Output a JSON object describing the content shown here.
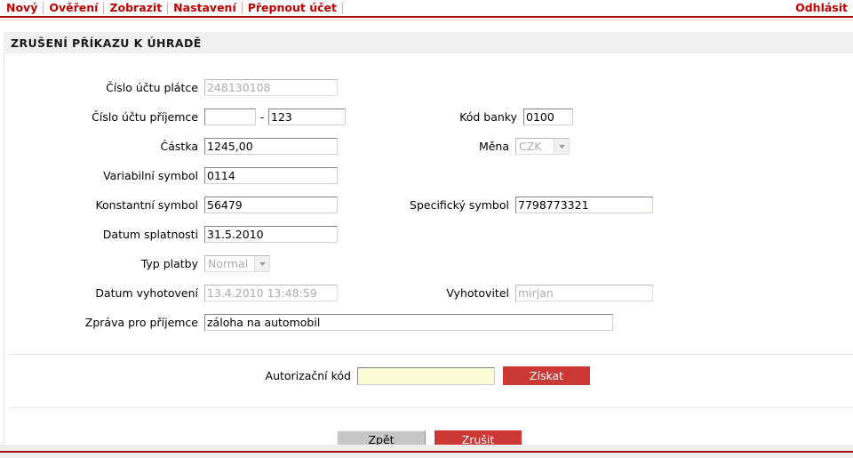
{
  "menu": {
    "items": [
      {
        "label": "Nový"
      },
      {
        "label": "Ověření"
      },
      {
        "label": "Zobrazit"
      },
      {
        "label": "Nastavení"
      },
      {
        "label": "Přepnout účet"
      }
    ],
    "logout_label": "Odhlásit"
  },
  "page": {
    "title": "ZRUŠENÍ PŘÍKAZU K ÚHRADĚ"
  },
  "form": {
    "payer_account": {
      "label": "Číslo účtu plátce",
      "value": "248130108",
      "disabled": true
    },
    "recipient_account": {
      "label": "Číslo účtu příjemce",
      "prefix_value": "",
      "separator": "-",
      "number_value": "123"
    },
    "bank_code": {
      "label": "Kód banky",
      "value": "0100"
    },
    "amount": {
      "label": "Částka",
      "value": "1245,00"
    },
    "currency": {
      "label": "Měna",
      "value": "CZK",
      "disabled": true,
      "options": [
        "CZK"
      ]
    },
    "variable_symbol": {
      "label": "Variabilní symbol",
      "value": "0114"
    },
    "constant_symbol": {
      "label": "Konstantní symbol",
      "value": "56479"
    },
    "specific_symbol": {
      "label": "Specifický symbol",
      "value": "7798773321"
    },
    "due_date": {
      "label": "Datum splatnosti",
      "value": "31.5.2010"
    },
    "payment_type": {
      "label": "Typ platby",
      "value": "Normal",
      "disabled": true,
      "options": [
        "Normal"
      ]
    },
    "created_date": {
      "label": "Datum vyhotovení",
      "value": "13.4.2010 13:48:59",
      "disabled": true
    },
    "creator": {
      "label": "Vyhotovitel",
      "value": "mirjan",
      "disabled": true
    },
    "message": {
      "label": "Zpráva pro příjemce",
      "value": "záloha na automobil"
    }
  },
  "authorization": {
    "label": "Autorizační kód",
    "value": "",
    "get_button_label": "Získat"
  },
  "actions": {
    "back_label": "Zpět",
    "cancel_label": "Zrušit"
  },
  "colors": {
    "accent_red": "#C00000",
    "button_red": "#CC3834",
    "rule_red": "#A50F0F",
    "title_bg": "#F0F0F0",
    "auth_field_bg": "#FCFBD8",
    "button_grey": "#C6C6C6"
  }
}
